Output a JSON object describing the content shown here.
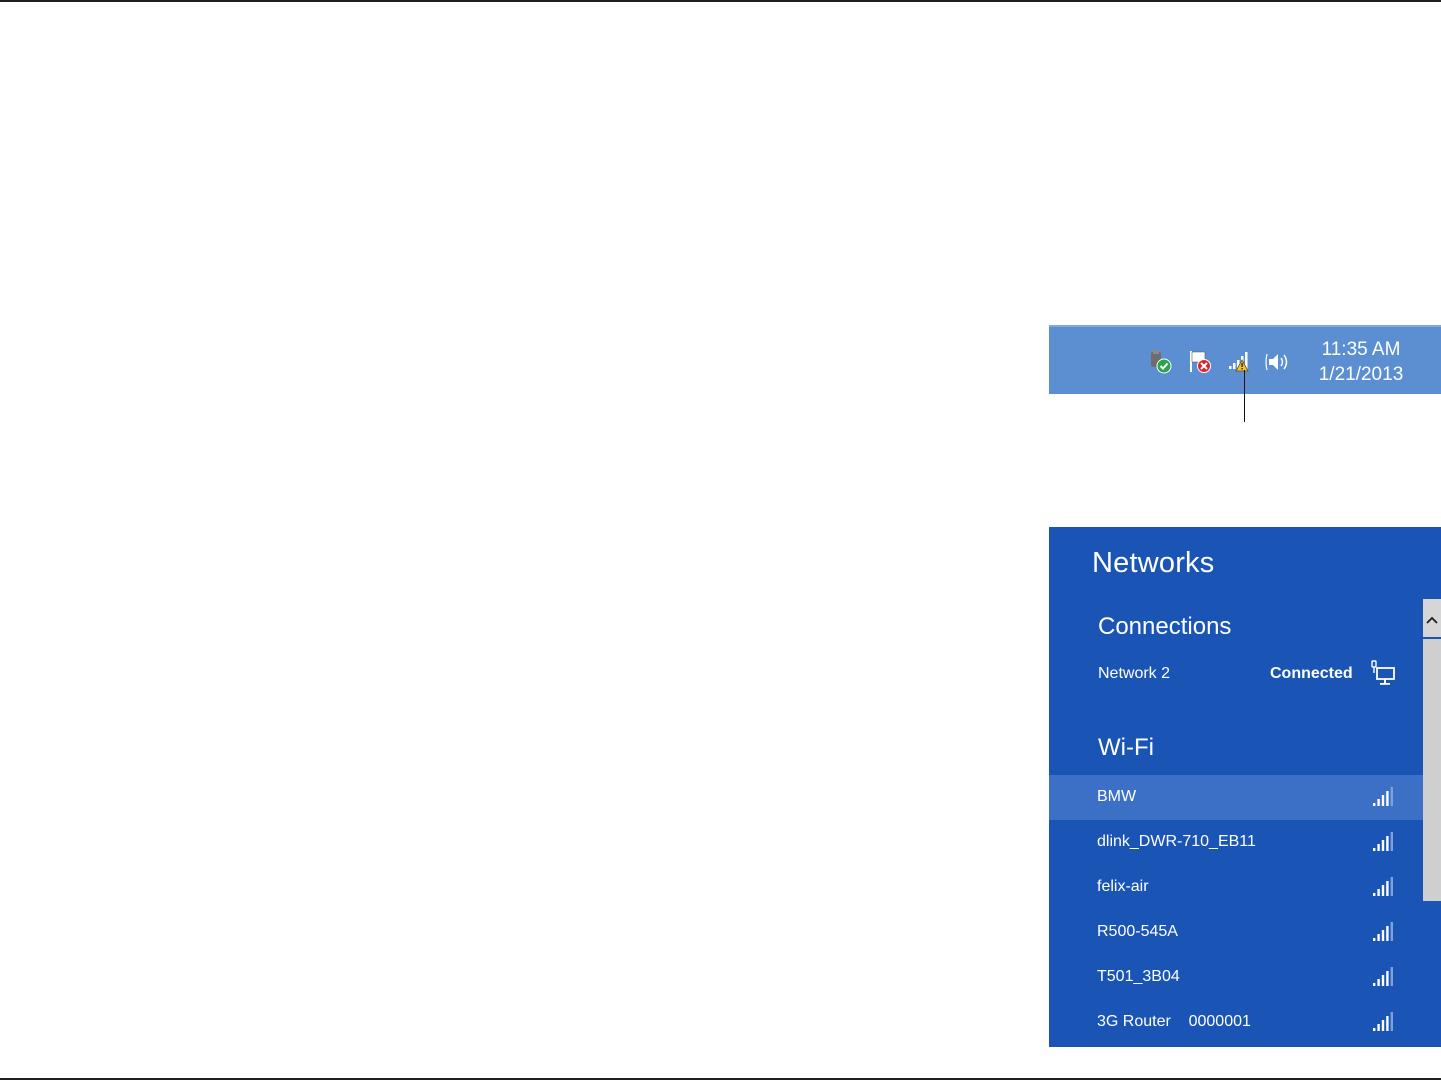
{
  "taskbar": {
    "time": "11:35 AM",
    "date": "1/21/2013",
    "tray_icons": [
      "security-shield-icon",
      "action-center-flag-icon",
      "network-warning-icon",
      "speaker-icon"
    ]
  },
  "flyout": {
    "title": "Networks",
    "connections": {
      "heading": "Connections",
      "items": [
        {
          "name": "Network  2",
          "status": "Connected",
          "icon": "wired-network-icon"
        }
      ]
    },
    "wifi": {
      "heading": "Wi-Fi",
      "networks": [
        {
          "name": "BMW",
          "selected": true,
          "signal_bars": 4
        },
        {
          "name": "dlink_DWR-710_EB11",
          "selected": false,
          "signal_bars": 4
        },
        {
          "name": "felix-air",
          "selected": false,
          "signal_bars": 4
        },
        {
          "name": "R500-545A",
          "selected": false,
          "signal_bars": 4
        },
        {
          "name": "T501_3B04",
          "selected": false,
          "signal_bars": 4
        },
        {
          "name": "3G Router    0000001",
          "selected": false,
          "signal_bars": 4
        }
      ]
    }
  },
  "colors": {
    "taskbar_bg": "#5b8fd1",
    "flyout_bg": "#1a55b5",
    "selected_row_bg": "#3b70c6",
    "text": "#ffffff"
  }
}
